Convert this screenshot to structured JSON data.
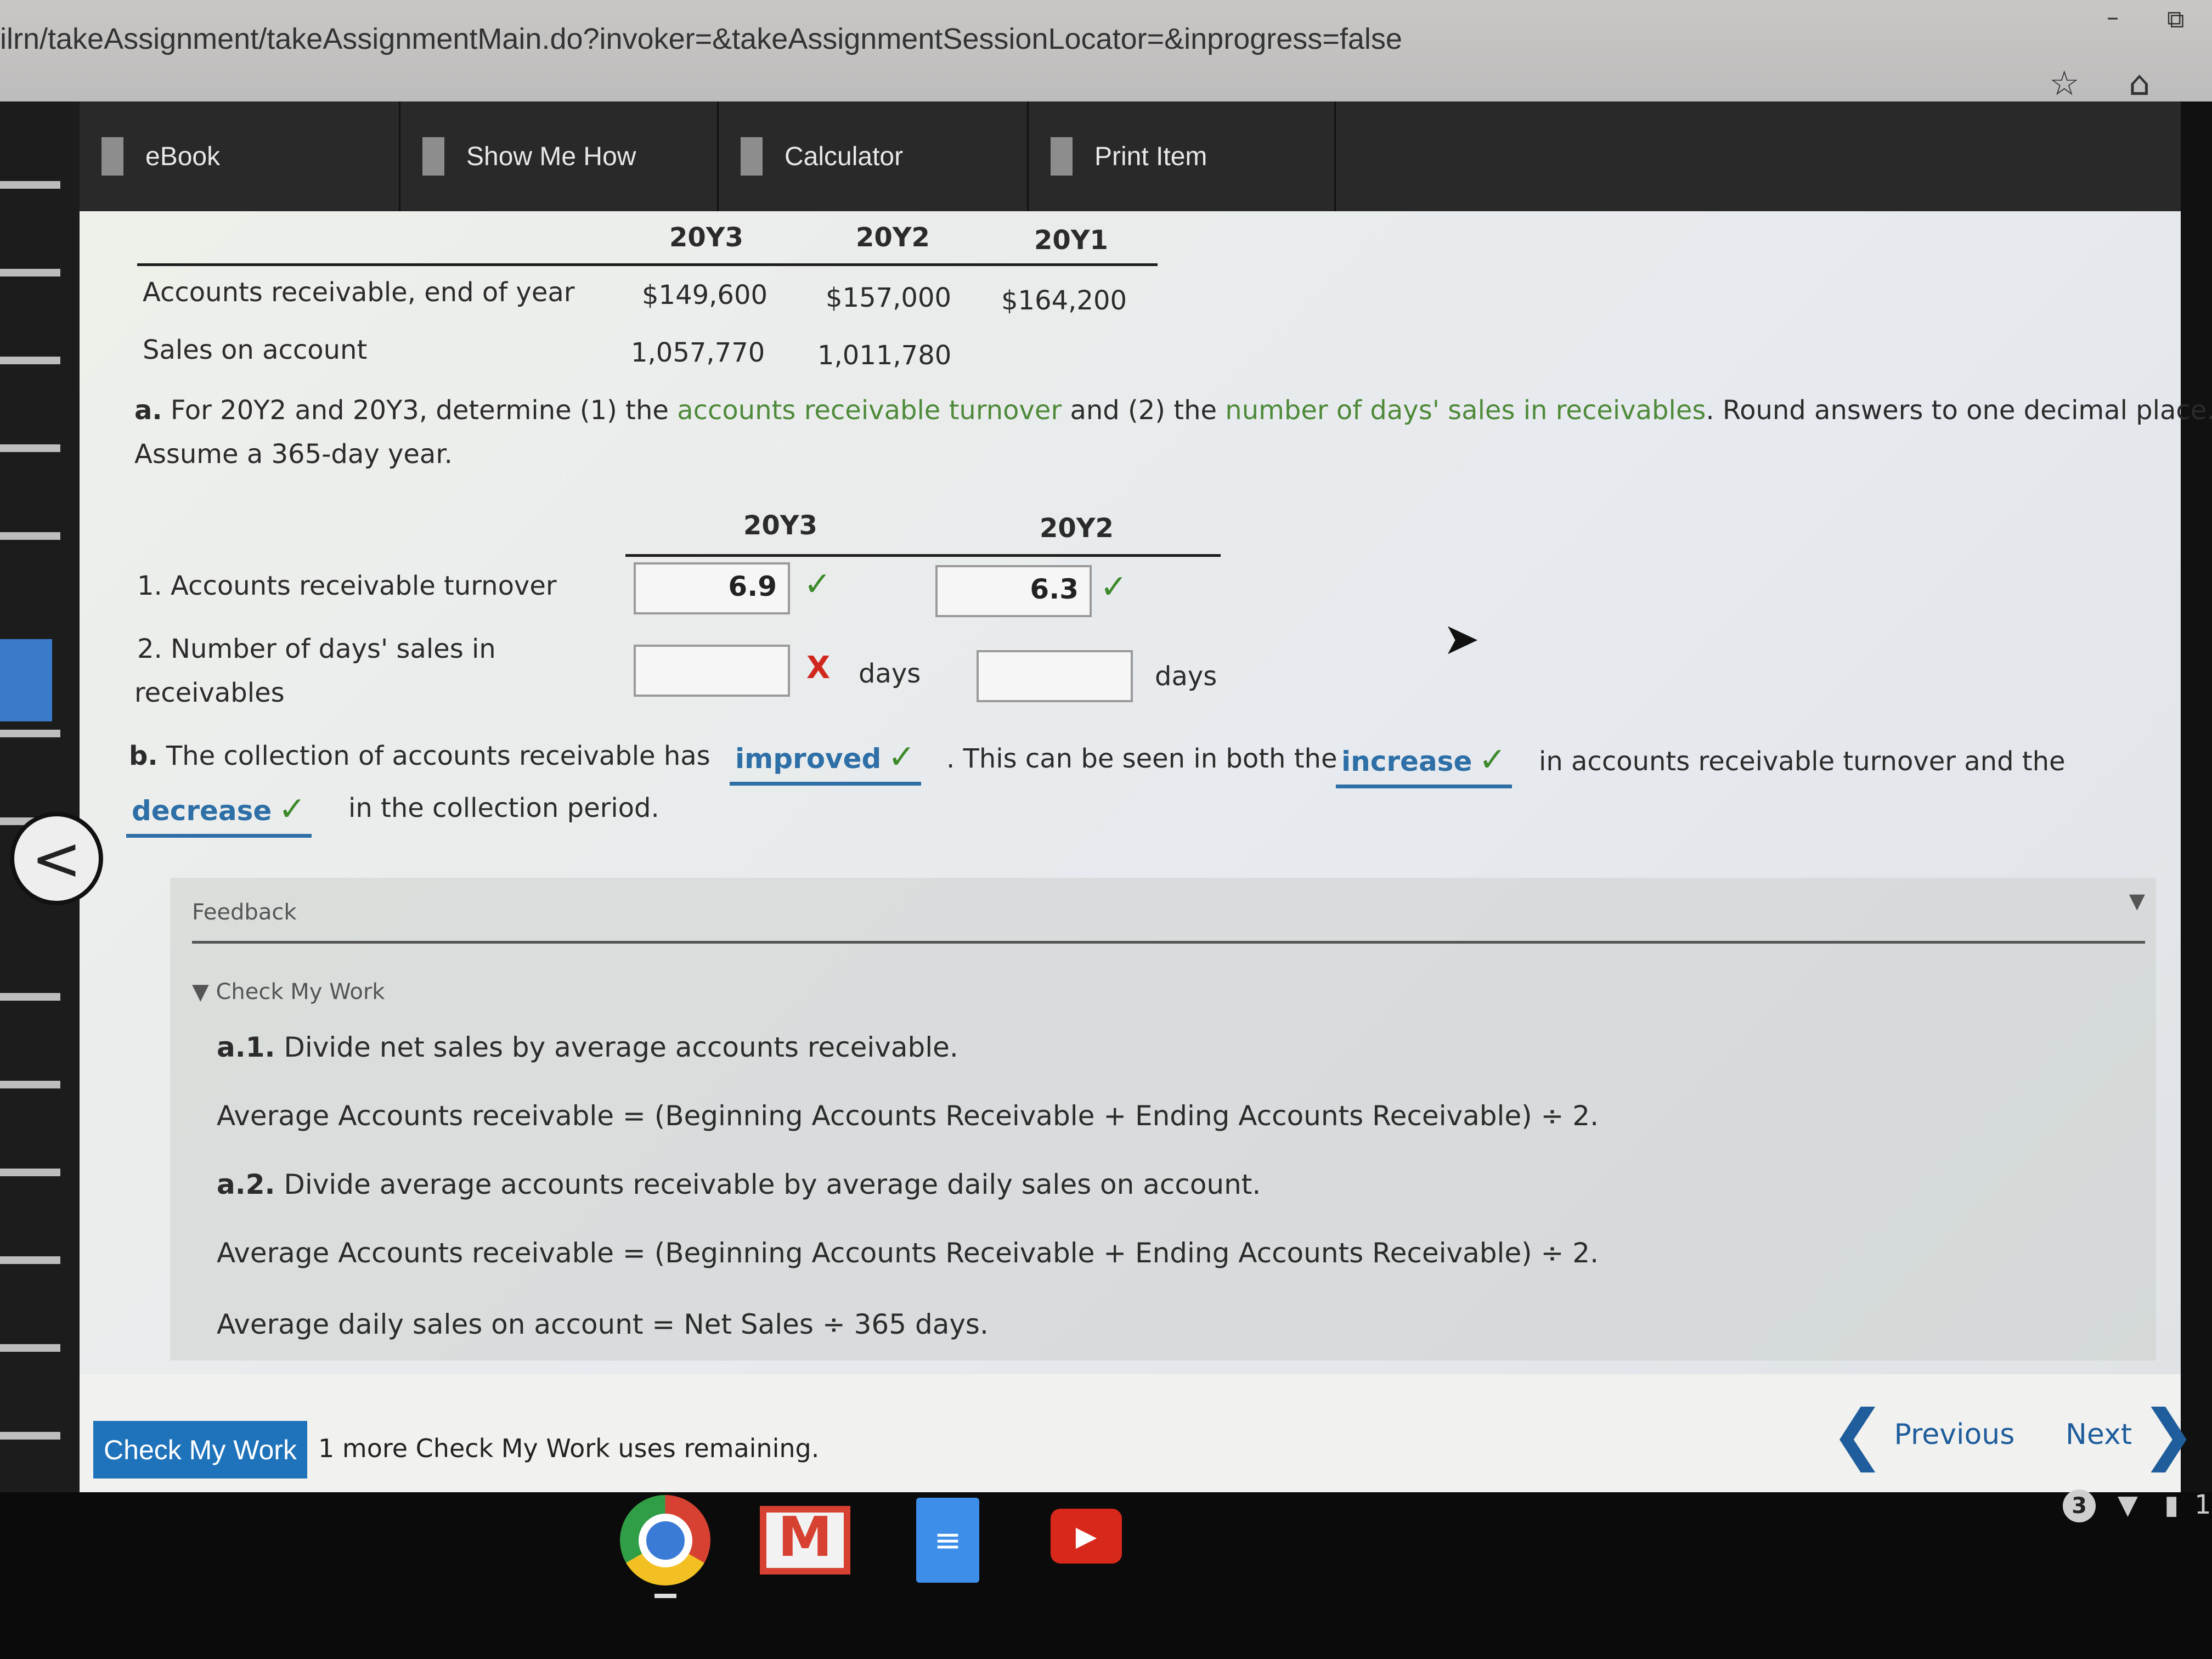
{
  "browser": {
    "url": "ilrn/takeAssignment/takeAssignmentMain.do?invoker=&takeAssignmentSessionLocator=&inprogress=false",
    "minimize_glyph": "–",
    "maximize_glyph": "⧉",
    "star_icon": "☆",
    "home_icon": "⌂"
  },
  "toolbar": {
    "items": [
      {
        "label": "eBook",
        "icon": "book-icon"
      },
      {
        "label": "Show Me How",
        "icon": "video-icon"
      },
      {
        "label": "Calculator",
        "icon": "calculator-icon"
      },
      {
        "label": "Print Item",
        "icon": "print-icon"
      }
    ]
  },
  "data_table": {
    "columns": [
      "20Y3",
      "20Y2",
      "20Y1"
    ],
    "rows": [
      {
        "label": "Accounts receivable, end of year",
        "values": [
          "$149,600",
          "$157,000",
          "$164,200"
        ]
      },
      {
        "label": "Sales on account",
        "values": [
          "1,057,770",
          "1,011,780",
          ""
        ]
      }
    ]
  },
  "question_a": {
    "prefix": "a.",
    "text_1": "For 20Y2 and 20Y3, determine (1) the",
    "link_1": "accounts receivable turnover",
    "text_2": "and (2) the",
    "link_2": "number of days' sales in receivables",
    "text_3": ". Round answers to one decimal place.",
    "line_2": "Assume a 365-day year.",
    "columns": [
      "20Y3",
      "20Y2"
    ],
    "rows": [
      {
        "label": "1.  Accounts receivable turnover",
        "values": [
          "6.9",
          "6.3"
        ],
        "status": [
          "correct",
          "correct"
        ]
      },
      {
        "label_line1": "2.  Number of days' sales in",
        "label_line2": "receivables",
        "values": [
          "",
          ""
        ],
        "status": [
          "incorrect",
          "none"
        ],
        "unit": "days"
      }
    ],
    "check_glyph": "✓",
    "cross_glyph": "X"
  },
  "question_b": {
    "prefix": "b.",
    "text_1": "The collection of accounts receivable has",
    "select_1": "improved",
    "text_2": ". This can be seen in both the",
    "select_2": "increase",
    "text_3": "in accounts receivable turnover and the",
    "select_3": "decrease",
    "text_4": "in the collection period."
  },
  "feedback": {
    "title": "Feedback",
    "collapse_glyph": "▼",
    "sub_title": "▼ Check My Work",
    "lines": [
      {
        "bold": "a.1.",
        "text": " Divide net sales by average accounts receivable."
      },
      {
        "bold": "",
        "text": "Average Accounts receivable = (Beginning Accounts Receivable + Ending Accounts Receivable) ÷ 2."
      },
      {
        "bold": "a.2.",
        "text": " Divide average accounts receivable by average daily sales on account."
      },
      {
        "bold": "",
        "text": "Average Accounts receivable = (Beginning Accounts Receivable + Ending Accounts Receivable) ÷ 2."
      },
      {
        "bold": "",
        "text": "Average daily sales on account = Net Sales ÷ 365 days."
      }
    ]
  },
  "footer": {
    "check_my_work": "Check My Work",
    "remaining_note": "1 more Check My Work uses remaining.",
    "previous": "Previous",
    "next": "Next",
    "prev_chevron": "❮",
    "next_chevron": "❯"
  },
  "back_glyph": "<",
  "shelf": {
    "apps": [
      "Chrome",
      "Gmail",
      "Docs",
      "YouTube"
    ],
    "notification_count": "3",
    "time_partial": "1"
  }
}
